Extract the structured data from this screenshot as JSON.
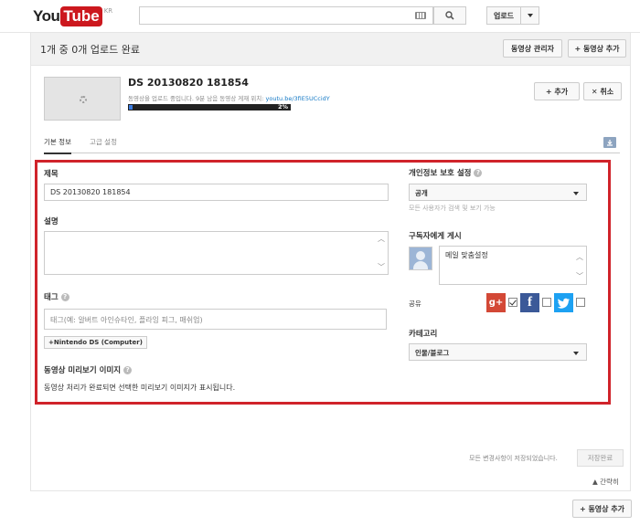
{
  "header": {
    "logo_you": "You",
    "logo_tube": "Tube",
    "logo_region": "KR",
    "upload_label": "업로드"
  },
  "upload_panel": {
    "summary": "1개 중 0개 업로드 완료",
    "video_manager_label": "동영상 관리자",
    "add_video_label": "+ 동영상 추가"
  },
  "video": {
    "title": "DS 20130820 181854",
    "status_text": "동영상을 업로드 중입니다. 9분 남음 동영상 게재 위치: ",
    "link": "youtu.be/3fiE5UCcidY",
    "progress_text": "2%",
    "progress": 0.02,
    "add_to_label": "+ 추가",
    "cancel_label": "✕ 취소"
  },
  "tabs": [
    {
      "label": "기본 정보",
      "active": true
    },
    {
      "label": "고급 설정",
      "active": false
    }
  ],
  "form": {
    "title_label": "제목",
    "title_value": "DS 20130820 181854",
    "description_label": "설명",
    "tags_label": "태그",
    "tags_placeholder": "태그(예: 알버트 아인슈타인, 플라잉 피그, 매쉬업)",
    "suggested_tag": "+Nintendo DS (Computer)",
    "thumbnail_label": "동영상 미리보기 이미지",
    "thumbnail_text": "동영상 처리가 완료되면 선택한 미리보기 이미지가 표시됩니다.",
    "privacy_label": "개인정보 보호 설정",
    "privacy_value": "공개",
    "privacy_hint": "모든 사용자가 검색 및 보기 가능",
    "subscribers_label": "구독자에게 게시",
    "subscribers_message": "메일 맞춤설정",
    "share_label": "공유",
    "category_label": "카테고리",
    "category_value": "인물/블로그"
  },
  "share": {
    "gplus_checked": true,
    "facebook_checked": false,
    "twitter_checked": false,
    "gplus_glyph": "g+",
    "facebook_glyph": "f"
  },
  "footer": {
    "saved_status": "모든 변경사항이 저장되었습니다.",
    "save_label": "저장완료",
    "collapse_label": "▲ 간략히",
    "add_video_label": "+ 동영상 추가"
  },
  "colors": {
    "highlight": "#d0232a",
    "progress": "#3a7be0",
    "link": "#167ac6"
  }
}
